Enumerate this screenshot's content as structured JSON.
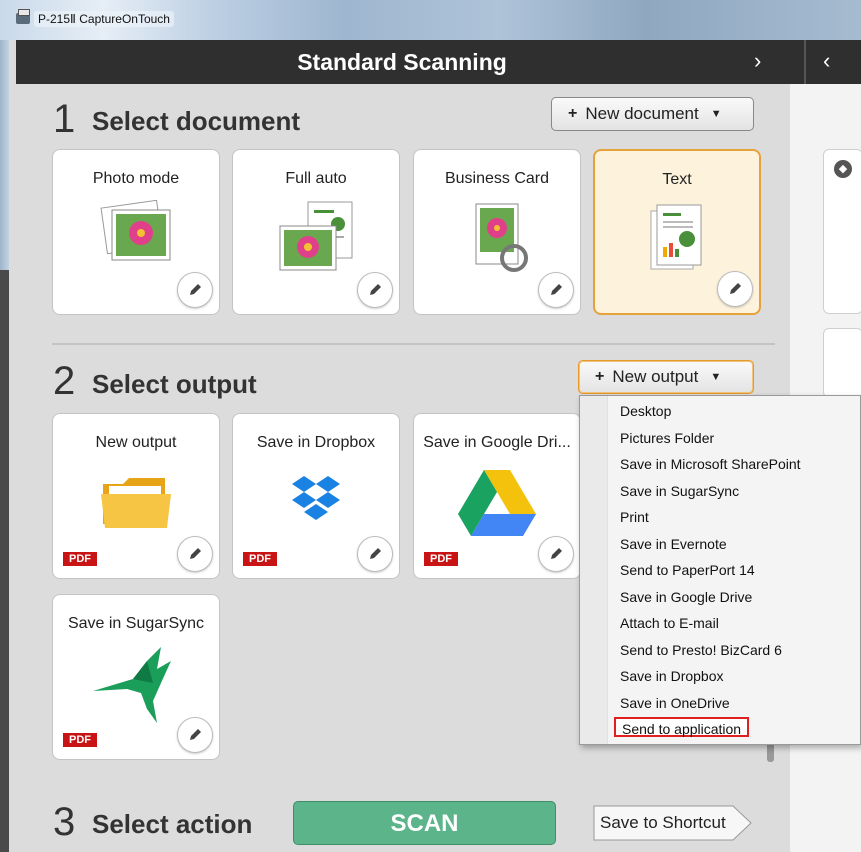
{
  "window": {
    "title": "P-215Ⅱ CaptureOnTouch"
  },
  "header": {
    "title": "Standard Scanning",
    "next_glyph": "›",
    "prev_glyph": "‹"
  },
  "step1": {
    "number": "1",
    "title": "Select document",
    "new_button": {
      "plus": "+",
      "label": "New document",
      "caret": "▼"
    },
    "cards": [
      {
        "label": "Photo mode",
        "icon": "photo-icon",
        "selected": false
      },
      {
        "label": "Full auto",
        "icon": "full-auto-icon",
        "selected": false
      },
      {
        "label": "Business Card",
        "icon": "business-card-icon",
        "selected": false
      },
      {
        "label": "Text",
        "icon": "text-document-icon",
        "selected": true
      }
    ]
  },
  "step2": {
    "number": "2",
    "title": "Select output",
    "new_button": {
      "plus": "+",
      "label": "New output",
      "caret": "▼"
    },
    "cards": [
      {
        "label": "New output",
        "icon": "folder-icon",
        "badge": "PDF"
      },
      {
        "label": "Save in Dropbox",
        "icon": "dropbox-icon",
        "badge": "PDF"
      },
      {
        "label": "Save in Google Dri...",
        "icon": "google-drive-icon",
        "badge": "PDF"
      },
      {
        "label": "Save in SugarSync",
        "icon": "sugarsync-icon",
        "badge": "PDF"
      }
    ]
  },
  "output_menu": {
    "items": [
      "Desktop",
      "Pictures Folder",
      "Save in Microsoft SharePoint",
      "Save in SugarSync",
      "Print",
      "Save in Evernote",
      "Send to PaperPort 14",
      "Save in Google Drive",
      "Attach to E-mail",
      "Send to Presto! BizCard 6",
      "Save in Dropbox",
      "Save in OneDrive",
      "Send to application"
    ],
    "highlighted": "Send to application"
  },
  "step3": {
    "number": "3",
    "title": "Select action",
    "scan_label": "SCAN",
    "shortcut_label": "Save to Shortcut"
  },
  "colors": {
    "accent_orange": "#e6a13d",
    "scan_green": "#5bb48a",
    "pdf_red": "#c81414",
    "highlight_red": "#e02020"
  }
}
